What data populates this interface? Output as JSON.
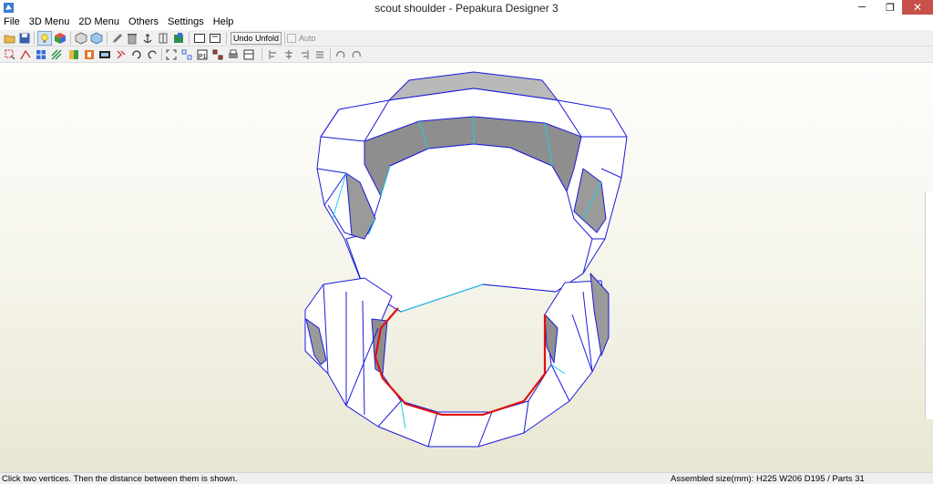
{
  "window": {
    "title": "scout shoulder - Pepakura Designer 3",
    "minimize_glyph": "─",
    "maximize_glyph": "❐",
    "close_glyph": "✕"
  },
  "menu": [
    "File",
    "3D Menu",
    "2D Menu",
    "Others",
    "Settings",
    "Help"
  ],
  "toolbar1": {
    "undo_unfold_label": "Undo Unfold",
    "auto_label": "Auto",
    "auto_checked": false,
    "icons": [
      "open-icon",
      "save-icon",
      "light-bulb-icon",
      "color-cube-icon",
      "wireframe-box-icon",
      "textured-box-icon",
      "pencil-icon",
      "trash-icon",
      "anchor-icon",
      "edge-icon",
      "flag-icon",
      "single-view-icon",
      "dual-view-icon"
    ]
  },
  "toolbar2": {
    "icons": [
      "select-icon",
      "join-icon",
      "grid-icon",
      "stripe-icon",
      "face-color-icon",
      "edge-color-icon",
      "zoom-icon",
      "link-icon",
      "rotate-icon",
      "move-icon",
      "select-frame-icon",
      "numbers-icon",
      "page-icon",
      "overlap-icon",
      "print-icon",
      "layout-icon",
      "align-left-icon",
      "align-center-icon",
      "align-right-icon",
      "align-justify-icon",
      "rotate-left-icon",
      "rotate-right-icon"
    ]
  },
  "status": {
    "hint": "Click two vertices. Then the distance between them is shown.",
    "assembled": "Assembled size(mm): H225 W206 D195 / Parts 31"
  },
  "colors": {
    "edge": "#1a1adc",
    "fold_line": "#18d0e8",
    "selected_edge": "#e01010",
    "face": "#ffffff",
    "shadow_face": "#8c8c8c"
  }
}
